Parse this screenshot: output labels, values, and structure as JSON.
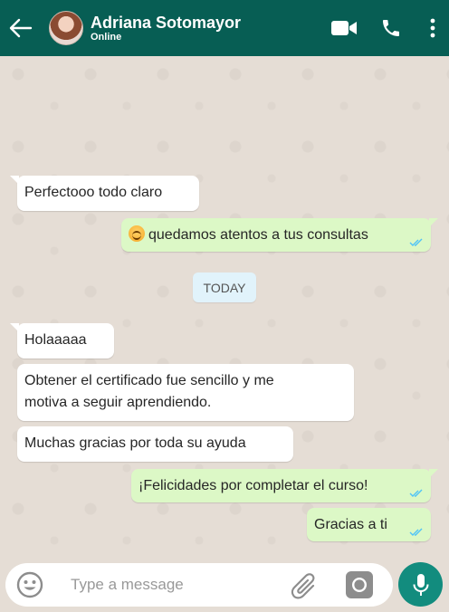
{
  "header": {
    "contact_name": "Adriana Sotomayor",
    "contact_status": "Online",
    "bg_color": "#075e54",
    "icons": [
      "back-arrow-icon",
      "video-call-icon",
      "phone-icon",
      "more-vert-icon"
    ]
  },
  "messages": {
    "m1": "Perfectooo todo claro",
    "m2": "quedamos atentos a tus consultas",
    "day_separator": "TODAY",
    "m3": "Holaaaaa",
    "m4_line1": "Obtener el certificado fue sencillo y me",
    "m4_line2": "motiva a seguir aprendiendo.",
    "m5": "Muchas gracias por toda su ayuda",
    "m6": "¡Felicidades por completar el curso!",
    "m7": "Gracias a ti"
  },
  "composer": {
    "placeholder": "Type a message",
    "icons": [
      "emoji-icon",
      "attachment-icon",
      "camera-icon",
      "mic-icon"
    ]
  },
  "colors": {
    "incoming": "#ffffff",
    "outgoing": "#dcf8c6",
    "read_tick": "#4fc3f7",
    "accent": "#128c7e"
  }
}
